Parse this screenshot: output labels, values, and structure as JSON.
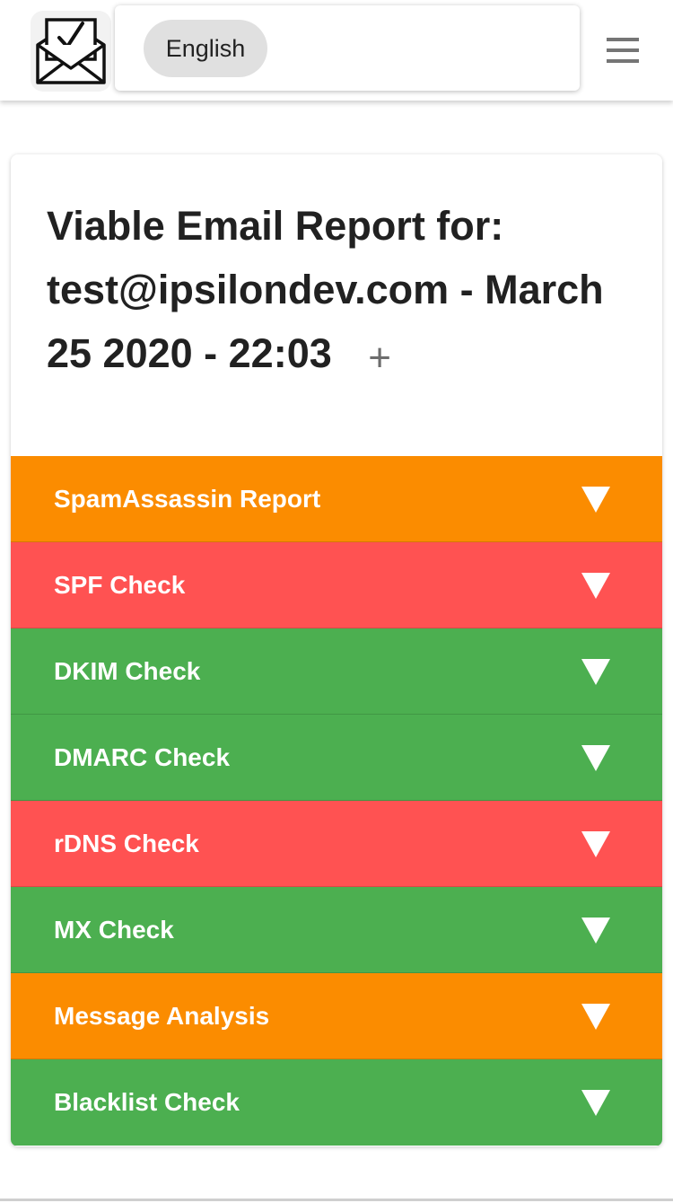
{
  "header": {
    "logo_icon": "envelope-check-icon",
    "language_label": "English",
    "menu_icon": "hamburger-menu-icon"
  },
  "report": {
    "title": "Viable Email Report for: test@ipsilondev.com - March 25 2020 - 22:03",
    "expand_label": "+",
    "sections": [
      {
        "label": "SpamAssassin Report",
        "status": "warning",
        "color": "#fb8c00"
      },
      {
        "label": "SPF Check",
        "status": "fail",
        "color": "#ff5252"
      },
      {
        "label": "DKIM Check",
        "status": "pass",
        "color": "#4caf50"
      },
      {
        "label": "DMARC Check",
        "status": "pass",
        "color": "#4caf50"
      },
      {
        "label": "rDNS Check",
        "status": "fail",
        "color": "#ff5252"
      },
      {
        "label": "MX Check",
        "status": "pass",
        "color": "#4caf50"
      },
      {
        "label": "Message Analysis",
        "status": "warning",
        "color": "#fb8c00"
      },
      {
        "label": "Blacklist Check",
        "status": "pass",
        "color": "#4caf50"
      }
    ],
    "section_arrow_icon": "triangle-down-icon"
  }
}
